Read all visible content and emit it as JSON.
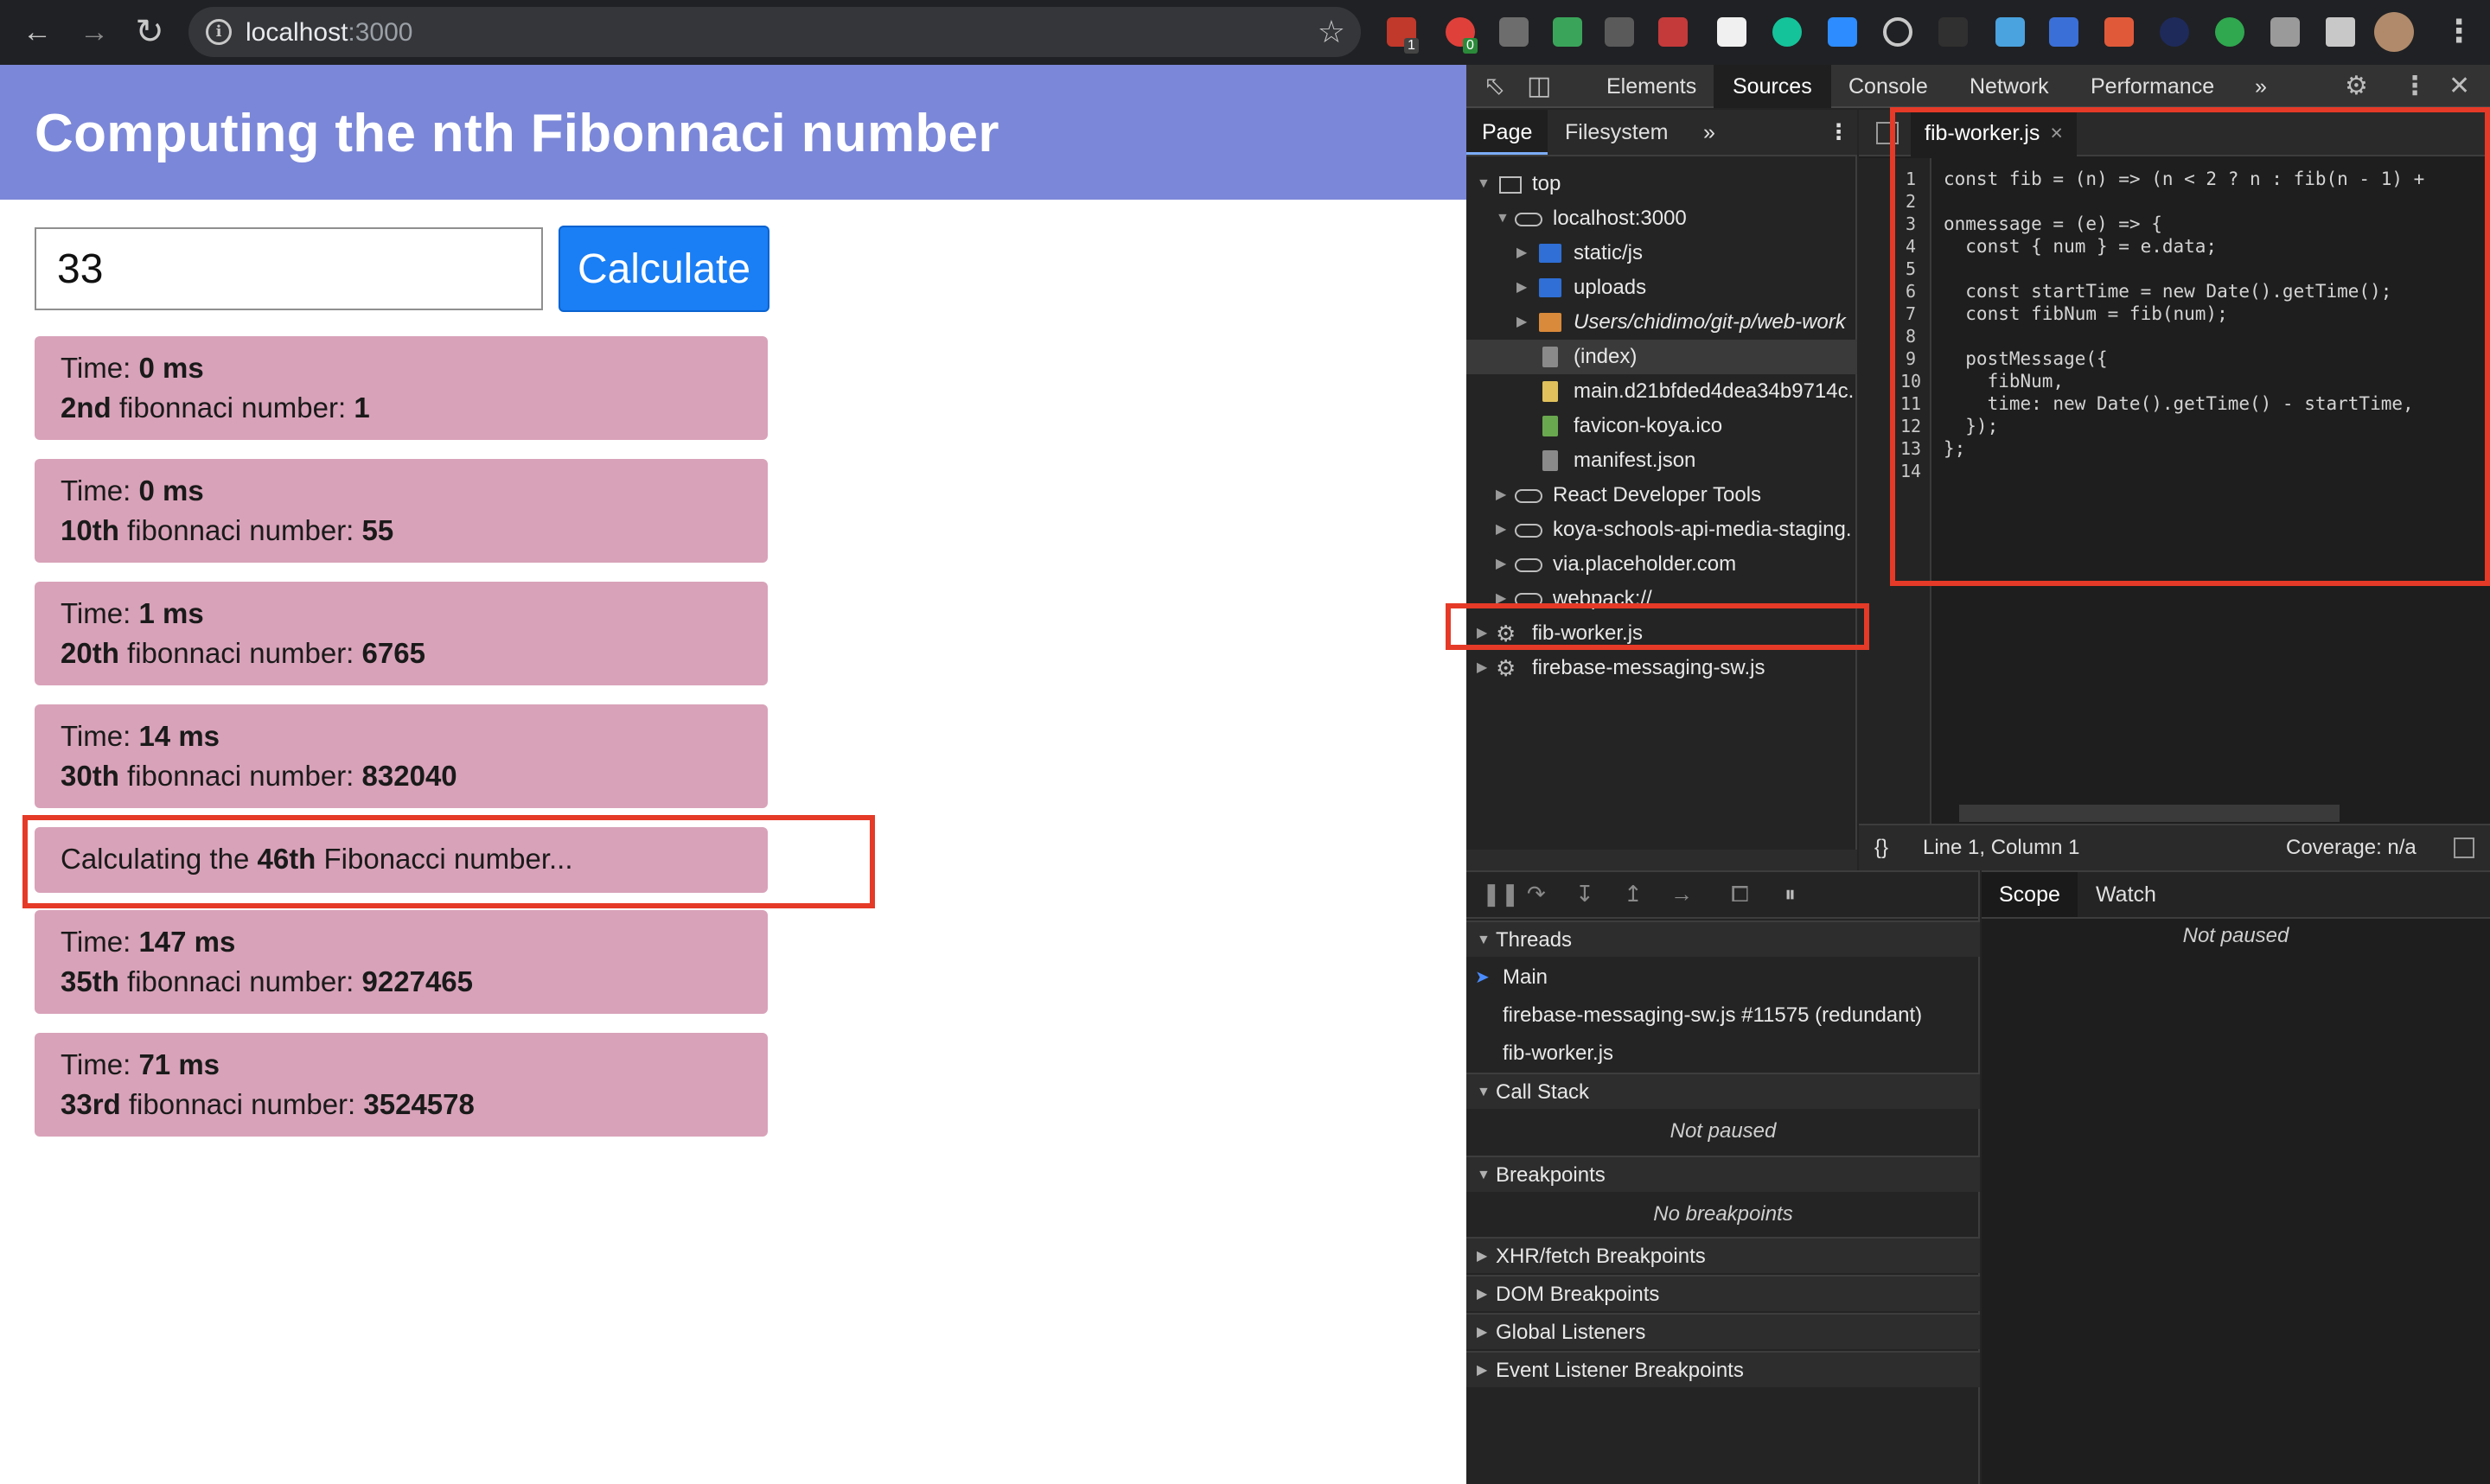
{
  "browser": {
    "url_host": "localhost",
    "url_port": ":3000",
    "back_icon": "arrow-left",
    "forward_icon": "arrow-right",
    "reload_icon": "reload",
    "star_icon": "star",
    "extension_badges": [
      "1",
      "0"
    ]
  },
  "app": {
    "title": "Computing the nth Fibonnaci number",
    "input_value": "33",
    "calculate_label": "Calculate",
    "results": [
      {
        "time_label": "Time: ",
        "time": "0 ms",
        "nth": "2nd",
        "mid": " fibonnaci number: ",
        "value": "1"
      },
      {
        "time_label": "Time: ",
        "time": "0 ms",
        "nth": "10th",
        "mid": " fibonnaci number: ",
        "value": "55"
      },
      {
        "time_label": "Time: ",
        "time": "1 ms",
        "nth": "20th",
        "mid": " fibonnaci number: ",
        "value": "6765"
      },
      {
        "time_label": "Time: ",
        "time": "14 ms",
        "nth": "30th",
        "mid": " fibonnaci number: ",
        "value": "832040"
      },
      {
        "pending_prefix": "Calculating the ",
        "nth": "46th",
        "pending_suffix": " Fibonacci number..."
      },
      {
        "time_label": "Time: ",
        "time": "147 ms",
        "nth": "35th",
        "mid": " fibonnaci number: ",
        "value": "9227465"
      },
      {
        "time_label": "Time: ",
        "time": "71 ms",
        "nth": "33rd",
        "mid": " fibonnaci number: ",
        "value": "3524578"
      }
    ],
    "colors": {
      "banner": "#7b87d8",
      "card": "#d8a2b8",
      "button": "#1a7ef5",
      "highlight": "#e53a27"
    }
  },
  "devtools": {
    "tabs": [
      "Elements",
      "Sources",
      "Console",
      "Network",
      "Performance"
    ],
    "active_tab": "Sources",
    "more_tabs": "»",
    "nav_tabs": [
      "Page",
      "Filesystem"
    ],
    "nav_more": "»",
    "tree": [
      {
        "label": "top",
        "type": "frame"
      },
      {
        "label": "localhost:3000",
        "type": "cloud"
      },
      {
        "label": "static/js",
        "type": "folder-blue"
      },
      {
        "label": "uploads",
        "type": "folder-blue"
      },
      {
        "label": "Users/chidimo/git-p/web-work",
        "type": "folder-orange"
      },
      {
        "label": "(index)",
        "type": "file-gray",
        "selected": true
      },
      {
        "label": "main.d21bfded4dea34b9714c.",
        "type": "file-yellow"
      },
      {
        "label": "favicon-koya.ico",
        "type": "file-green"
      },
      {
        "label": "manifest.json",
        "type": "file-gray"
      },
      {
        "label": "React Developer Tools",
        "type": "cloud"
      },
      {
        "label": "koya-schools-api-media-staging.",
        "type": "cloud"
      },
      {
        "label": "via.placeholder.com",
        "type": "cloud"
      },
      {
        "label": "webpack://",
        "type": "cloud"
      },
      {
        "label": "fib-worker.js",
        "type": "gear"
      },
      {
        "label": "firebase-messaging-sw.js",
        "type": "gear"
      }
    ],
    "editor_tab": "fib-worker.js",
    "editor_tab_close": "×",
    "line_numbers": [
      "1",
      "2",
      "3",
      "4",
      "5",
      "6",
      "7",
      "8",
      "9",
      "10",
      "11",
      "12",
      "13",
      "14"
    ],
    "code_lines": [
      "const fib = (n) => (n < 2 ? n : fib(n - 1) +",
      "",
      "onmessage = (e) => {",
      "  const { num } = e.data;",
      "",
      "  const startTime = new Date().getTime();",
      "  const fibNum = fib(num);",
      "",
      "  postMessage({",
      "    fibNum,",
      "    time: new Date().getTime() - startTime,",
      "  });",
      "};",
      ""
    ],
    "status": {
      "braces": "{}",
      "position": "Line 1, Column 1",
      "coverage": "Coverage: n/a"
    },
    "threads": {
      "title": "Threads",
      "items": [
        "Main",
        "firebase-messaging-sw.js #11575 (redundant)",
        "fib-worker.js"
      ]
    },
    "call_stack": {
      "title": "Call Stack",
      "empty": "Not paused"
    },
    "breakpoints": {
      "title": "Breakpoints",
      "empty": "No breakpoints"
    },
    "collapsed_sections": [
      "XHR/fetch Breakpoints",
      "DOM Breakpoints",
      "Global Listeners",
      "Event Listener Breakpoints"
    ],
    "right_tabs": [
      "Scope",
      "Watch"
    ],
    "scope_empty": "Not paused"
  }
}
